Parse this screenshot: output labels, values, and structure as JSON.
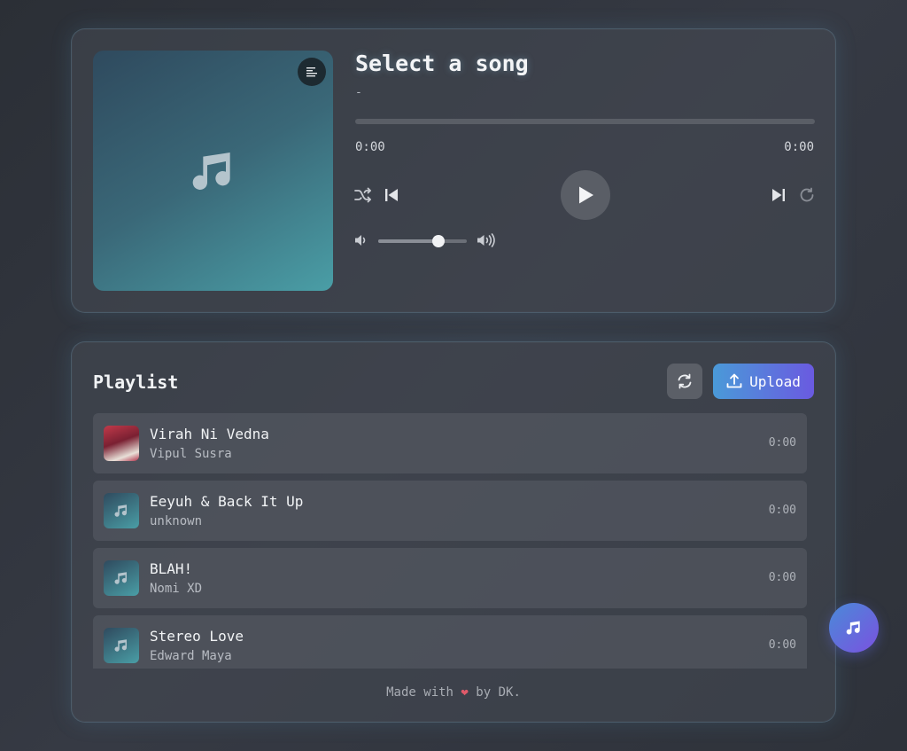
{
  "player": {
    "title": "Select a song",
    "artist": "-",
    "time_current": "0:00",
    "time_total": "0:00",
    "progress": 0,
    "volume": 0.68,
    "icons": {
      "lyrics": "lyrics-icon",
      "shuffle": "shuffle-icon",
      "previous": "skip-previous-icon",
      "play": "play-icon",
      "next": "skip-next-icon",
      "repeat": "repeat-icon",
      "volume_low": "volume-down-icon",
      "volume_high": "volume-up-icon",
      "art": "music-note-icon"
    }
  },
  "playlist": {
    "title": "Playlist",
    "upload_label": "Upload",
    "tracks": [
      {
        "name": "Virah Ni Vedna",
        "artist": "Vipul Susra",
        "duration": "0:00",
        "has_cover": true
      },
      {
        "name": "Eeyuh & Back It Up",
        "artist": "unknown",
        "duration": "0:00",
        "has_cover": false
      },
      {
        "name": "BLAH!",
        "artist": "Nomi XD",
        "duration": "0:00",
        "has_cover": false
      },
      {
        "name": "Stereo Love",
        "artist": "Edward Maya",
        "duration": "0:00",
        "has_cover": false
      }
    ]
  },
  "footer": {
    "prefix": "Made with",
    "heart": "❤",
    "suffix": "by DK."
  },
  "colors": {
    "accent_start": "#4a9ad8",
    "accent_end": "#6a5ae0",
    "heart": "#e05a6a"
  }
}
